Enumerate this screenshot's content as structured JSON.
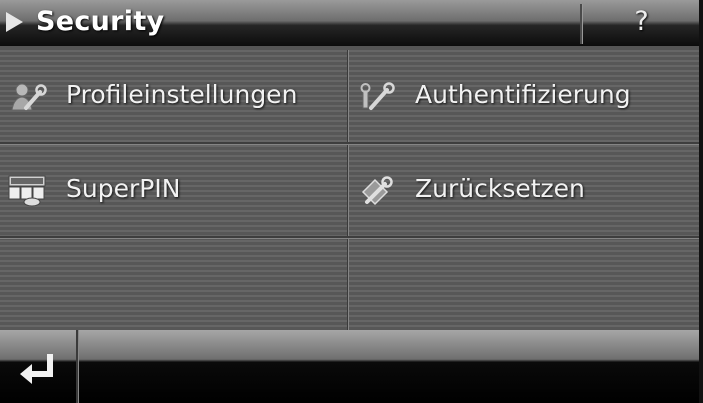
{
  "header": {
    "title": "Security",
    "help_label": "?"
  },
  "menu": {
    "items": [
      {
        "label": "Profileinstellungen",
        "icon": "wrench-profile-icon"
      },
      {
        "label": "Authentifizierung",
        "icon": "key-wrench-icon"
      },
      {
        "label": "SuperPIN",
        "icon": "superpin-icon"
      },
      {
        "label": "Zurücksetzen",
        "icon": "reset-wrench-icon"
      }
    ]
  },
  "footer": {
    "back_icon": "return-arrow-icon"
  },
  "colors": {
    "text": "#f2f2f2",
    "panel": "#5e5e5e",
    "bar_dark": "#0c0c0c"
  }
}
